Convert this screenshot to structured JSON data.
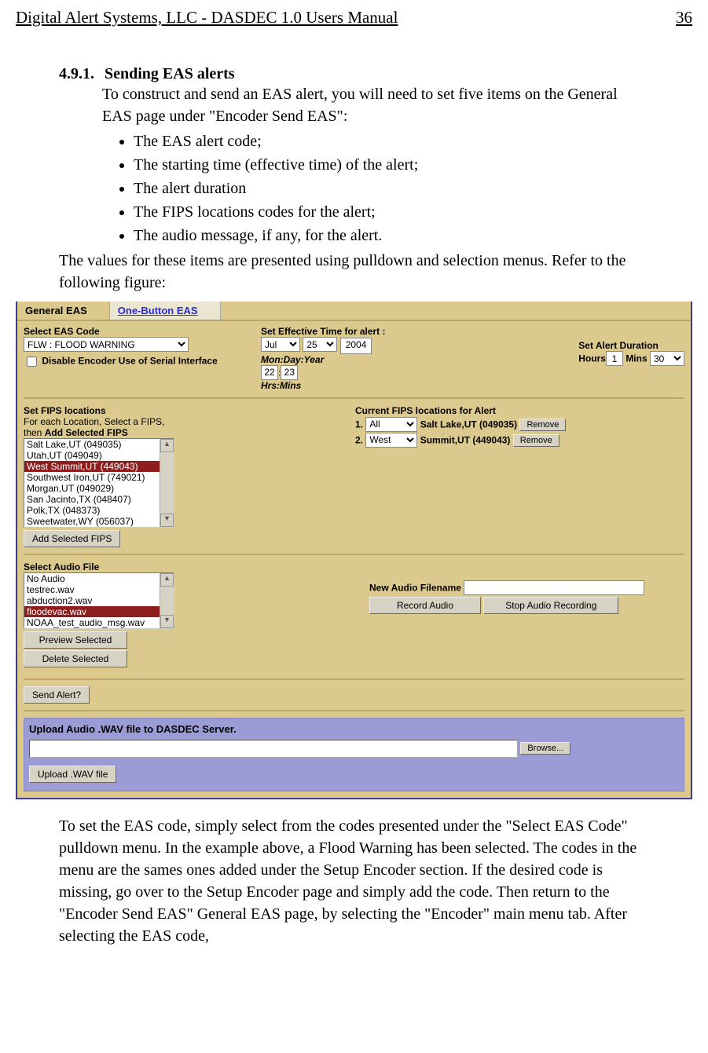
{
  "header": {
    "left": "Digital Alert Systems, LLC - DASDEC 1.0 Users Manual",
    "right": "36"
  },
  "section": {
    "number": "4.9.1.",
    "title": "Sending EAS alerts"
  },
  "intro": "To construct and send an EAS alert, you will need to set five items on the General EAS page under \"Encoder Send EAS\":",
  "bullets": [
    "The EAS alert code;",
    "The starting time (effective time) of the alert;",
    "The alert duration",
    "The FIPS locations codes for the alert;",
    "The audio message, if any, for the alert."
  ],
  "after_bullets": "The values for these items are presented using pulldown and selection menus. Refer to the following figure:",
  "ui": {
    "tabs": {
      "general": "General EAS",
      "onebutton": "One-Button EAS"
    },
    "eas_code": {
      "label": "Select EAS Code",
      "value": "FLW : FLOOD WARNING",
      "disable_chk": "Disable Encoder Use of Serial Interface"
    },
    "effective": {
      "label": "Set Effective Time for alert :",
      "month": "Jul",
      "day": "25",
      "year": "2004",
      "mday_lbl": "Mon:Day:Year",
      "hrs": "22",
      "mins": "23",
      "hrsmins_lbl": "Hrs:Mins"
    },
    "duration": {
      "label": "Set Alert Duration",
      "hours_lbl": "Hours",
      "hours": "1",
      "mins_lbl": "Mins",
      "mins": "30"
    },
    "fips": {
      "label": "Set FIPS locations",
      "hint_l1": "For each Location, Select a FIPS,",
      "hint_l2": "then",
      "hint_bold": "Add Selected FIPS",
      "items": [
        "Salt Lake,UT (049035)",
        "Utah,UT (049049)",
        "West Summit,UT (449043)",
        "Southwest Iron,UT (749021)",
        "Morgan,UT (049029)",
        "San Jacinto,TX (048407)",
        "Polk,TX (048373)",
        "Sweetwater,WY (056037)"
      ],
      "selected_index": 2,
      "add_btn": "Add Selected FIPS"
    },
    "current_fips": {
      "label": "Current FIPS locations for Alert",
      "rows": [
        {
          "n": "1.",
          "sel": "All",
          "txt": "Salt Lake,UT (049035)",
          "btn": "Remove"
        },
        {
          "n": "2.",
          "sel": "West",
          "txt": "Summit,UT (449043)",
          "btn": "Remove"
        }
      ]
    },
    "audio": {
      "label": "Select Audio File",
      "items": [
        "No Audio",
        "testrec.wav",
        "abduction2.wav",
        "floodevac.wav",
        "NOAA_test_audio_msg.wav"
      ],
      "selected_index": 3,
      "preview_btn": "Preview Selected",
      "delete_btn": "Delete Selected"
    },
    "newaudio": {
      "label": "New Audio Filename",
      "record_btn": "Record Audio",
      "stop_btn": "Stop Audio Recording"
    },
    "send_btn": "Send Alert?",
    "upload": {
      "title": "Upload Audio .WAV file to DASDEC Server.",
      "browse_btn": "Browse...",
      "upload_btn": "Upload .WAV file"
    }
  },
  "footer_para": "To set the EAS code, simply select from the codes presented under the \"Select EAS Code\" pulldown menu. In the example above, a Flood Warning has been selected. The codes in the menu are the sames ones added under the Setup Encoder section. If the desired code is missing, go over to the Setup Encoder page and simply add the code. Then return to the \"Encoder Send EAS\" General EAS page,  by selecting the \"Encoder\" main menu tab. After selecting the EAS code,"
}
